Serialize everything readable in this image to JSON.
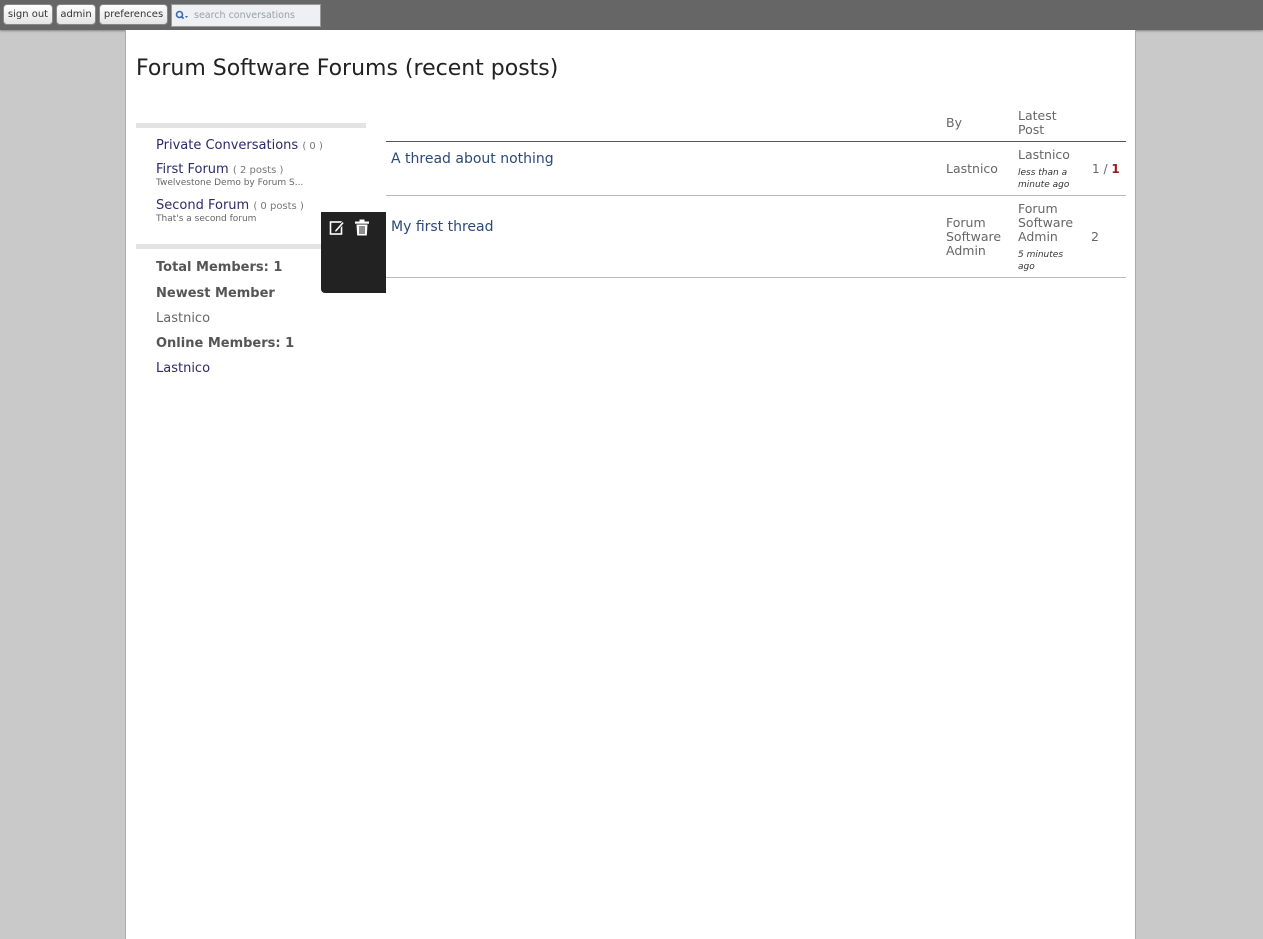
{
  "topbar": {
    "sign_out": "sign out",
    "admin": "admin",
    "preferences": "preferences",
    "search_placeholder": "search conversations"
  },
  "page_title": "Forum Software Forums (recent posts)",
  "sidebar": {
    "forums": [
      {
        "name": "Private Conversations",
        "count": "( 0 )",
        "description": ""
      },
      {
        "name": "First Forum",
        "count": "( 2 posts )",
        "description": "Twelvestone Demo by Forum S..."
      },
      {
        "name": "Second Forum",
        "count": "( 0 posts )",
        "description": "That's a second forum"
      }
    ],
    "stats": {
      "total_members": "Total Members: 1",
      "newest_member_label": "Newest Member",
      "newest_member": "Lastnico",
      "online_members": "Online Members: 1",
      "online_member": "Lastnico"
    }
  },
  "toolbox": {
    "icons": [
      "edit-icon",
      "trash-icon"
    ]
  },
  "table": {
    "headers": {
      "by": "By",
      "latest_post": "Latest Post"
    },
    "rows": [
      {
        "title": "A thread about nothing",
        "by": "Lastnico",
        "latest_author": "Lastnico",
        "latest_time": "less than a minute ago",
        "pages_text": "1 /",
        "pages_current": "1"
      },
      {
        "title": "My first thread",
        "by": "Forum Software Admin",
        "latest_author": "Forum Software Admin",
        "latest_time": "5 minutes ago",
        "replies": "2"
      }
    ]
  },
  "colors": {
    "background": "#c9c9c9",
    "topbar": "#666666",
    "link": "#2b2a6b",
    "current_page": "#9b1c1c"
  }
}
